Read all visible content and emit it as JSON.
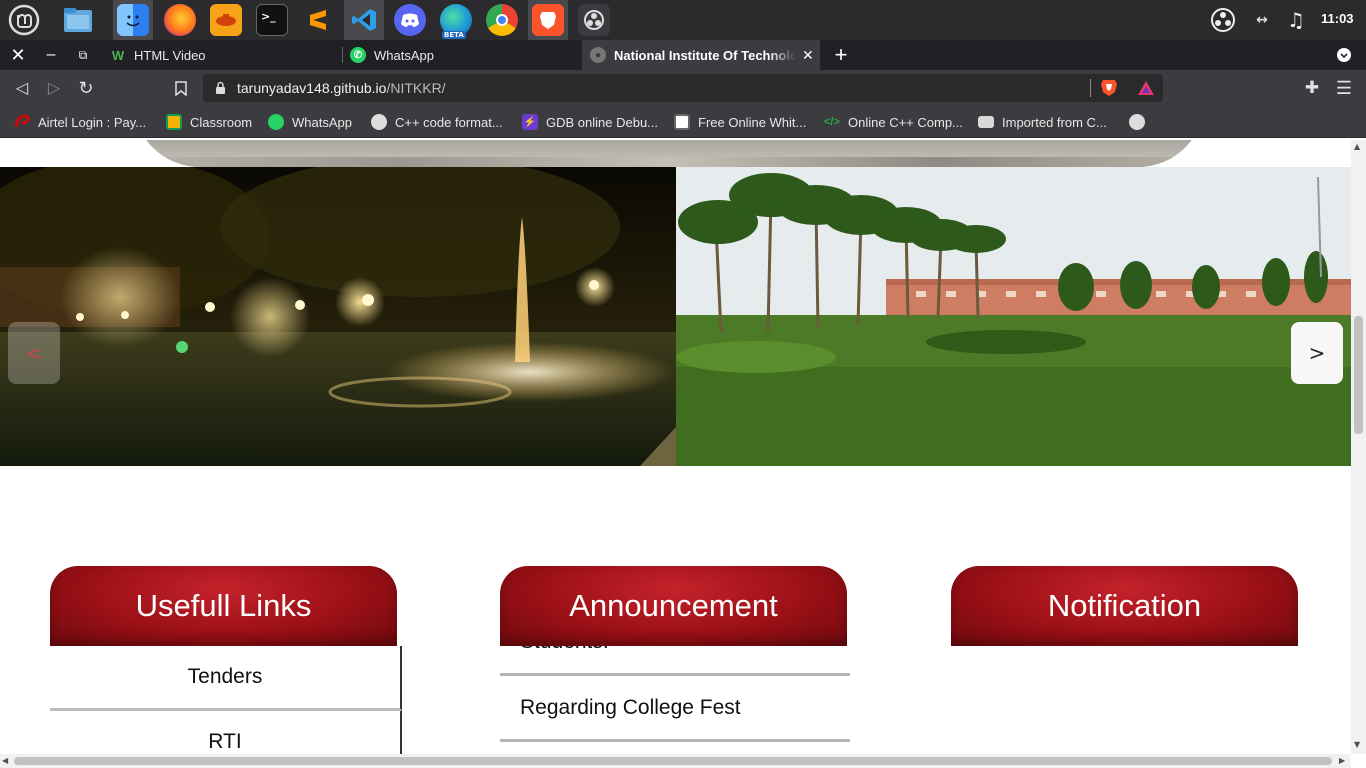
{
  "taskbar": {
    "apps": [
      "linux-mint-menu",
      "files",
      "finder",
      "firefox",
      "genie",
      "terminal",
      "sublime-text",
      "vscode",
      "discord",
      "edge-beta",
      "chrome",
      "brave",
      "obs"
    ],
    "edge_badge": "BETA",
    "clock": "11:03"
  },
  "browser": {
    "tabs": [
      {
        "label": "HTML Video",
        "icon": "w-icon"
      },
      {
        "label": "WhatsApp",
        "icon": "whatsapp-icon"
      },
      {
        "label": "National Institute Of Technolo",
        "icon": "globe-icon",
        "active": true
      }
    ],
    "url_host": "tarunyadav148.github.io",
    "url_path": "/NITKKR/",
    "bookmarks": [
      {
        "label": "Airtel Login : Pay...",
        "icon": "airtel-icon"
      },
      {
        "label": "Classroom",
        "icon": "classroom-icon"
      },
      {
        "label": "WhatsApp",
        "icon": "whatsapp-icon"
      },
      {
        "label": "C++ code format...",
        "icon": "globe-icon"
      },
      {
        "label": "GDB online Debu...",
        "icon": "gdb-icon"
      },
      {
        "label": "Free Online Whit...",
        "icon": "whiteboard-icon"
      },
      {
        "label": "Online C++ Comp...",
        "icon": "code-icon"
      },
      {
        "label": "Imported from C...",
        "icon": "folder-icon"
      }
    ]
  },
  "page": {
    "slider": {
      "prev_label": "<",
      "next_label": ">"
    },
    "boxes": {
      "links": {
        "title": "Usefull Links",
        "items": [
          "Tenders",
          "RTI"
        ]
      },
      "announcement": {
        "title": "Announcement",
        "items": [
          "Students.",
          "Regarding College Fest"
        ]
      },
      "notification": {
        "title": "Notification"
      }
    }
  },
  "colors": {
    "accent_red": "#9b1016",
    "taskbar": "#2b2b2d",
    "toolbar": "#3b3b40"
  }
}
